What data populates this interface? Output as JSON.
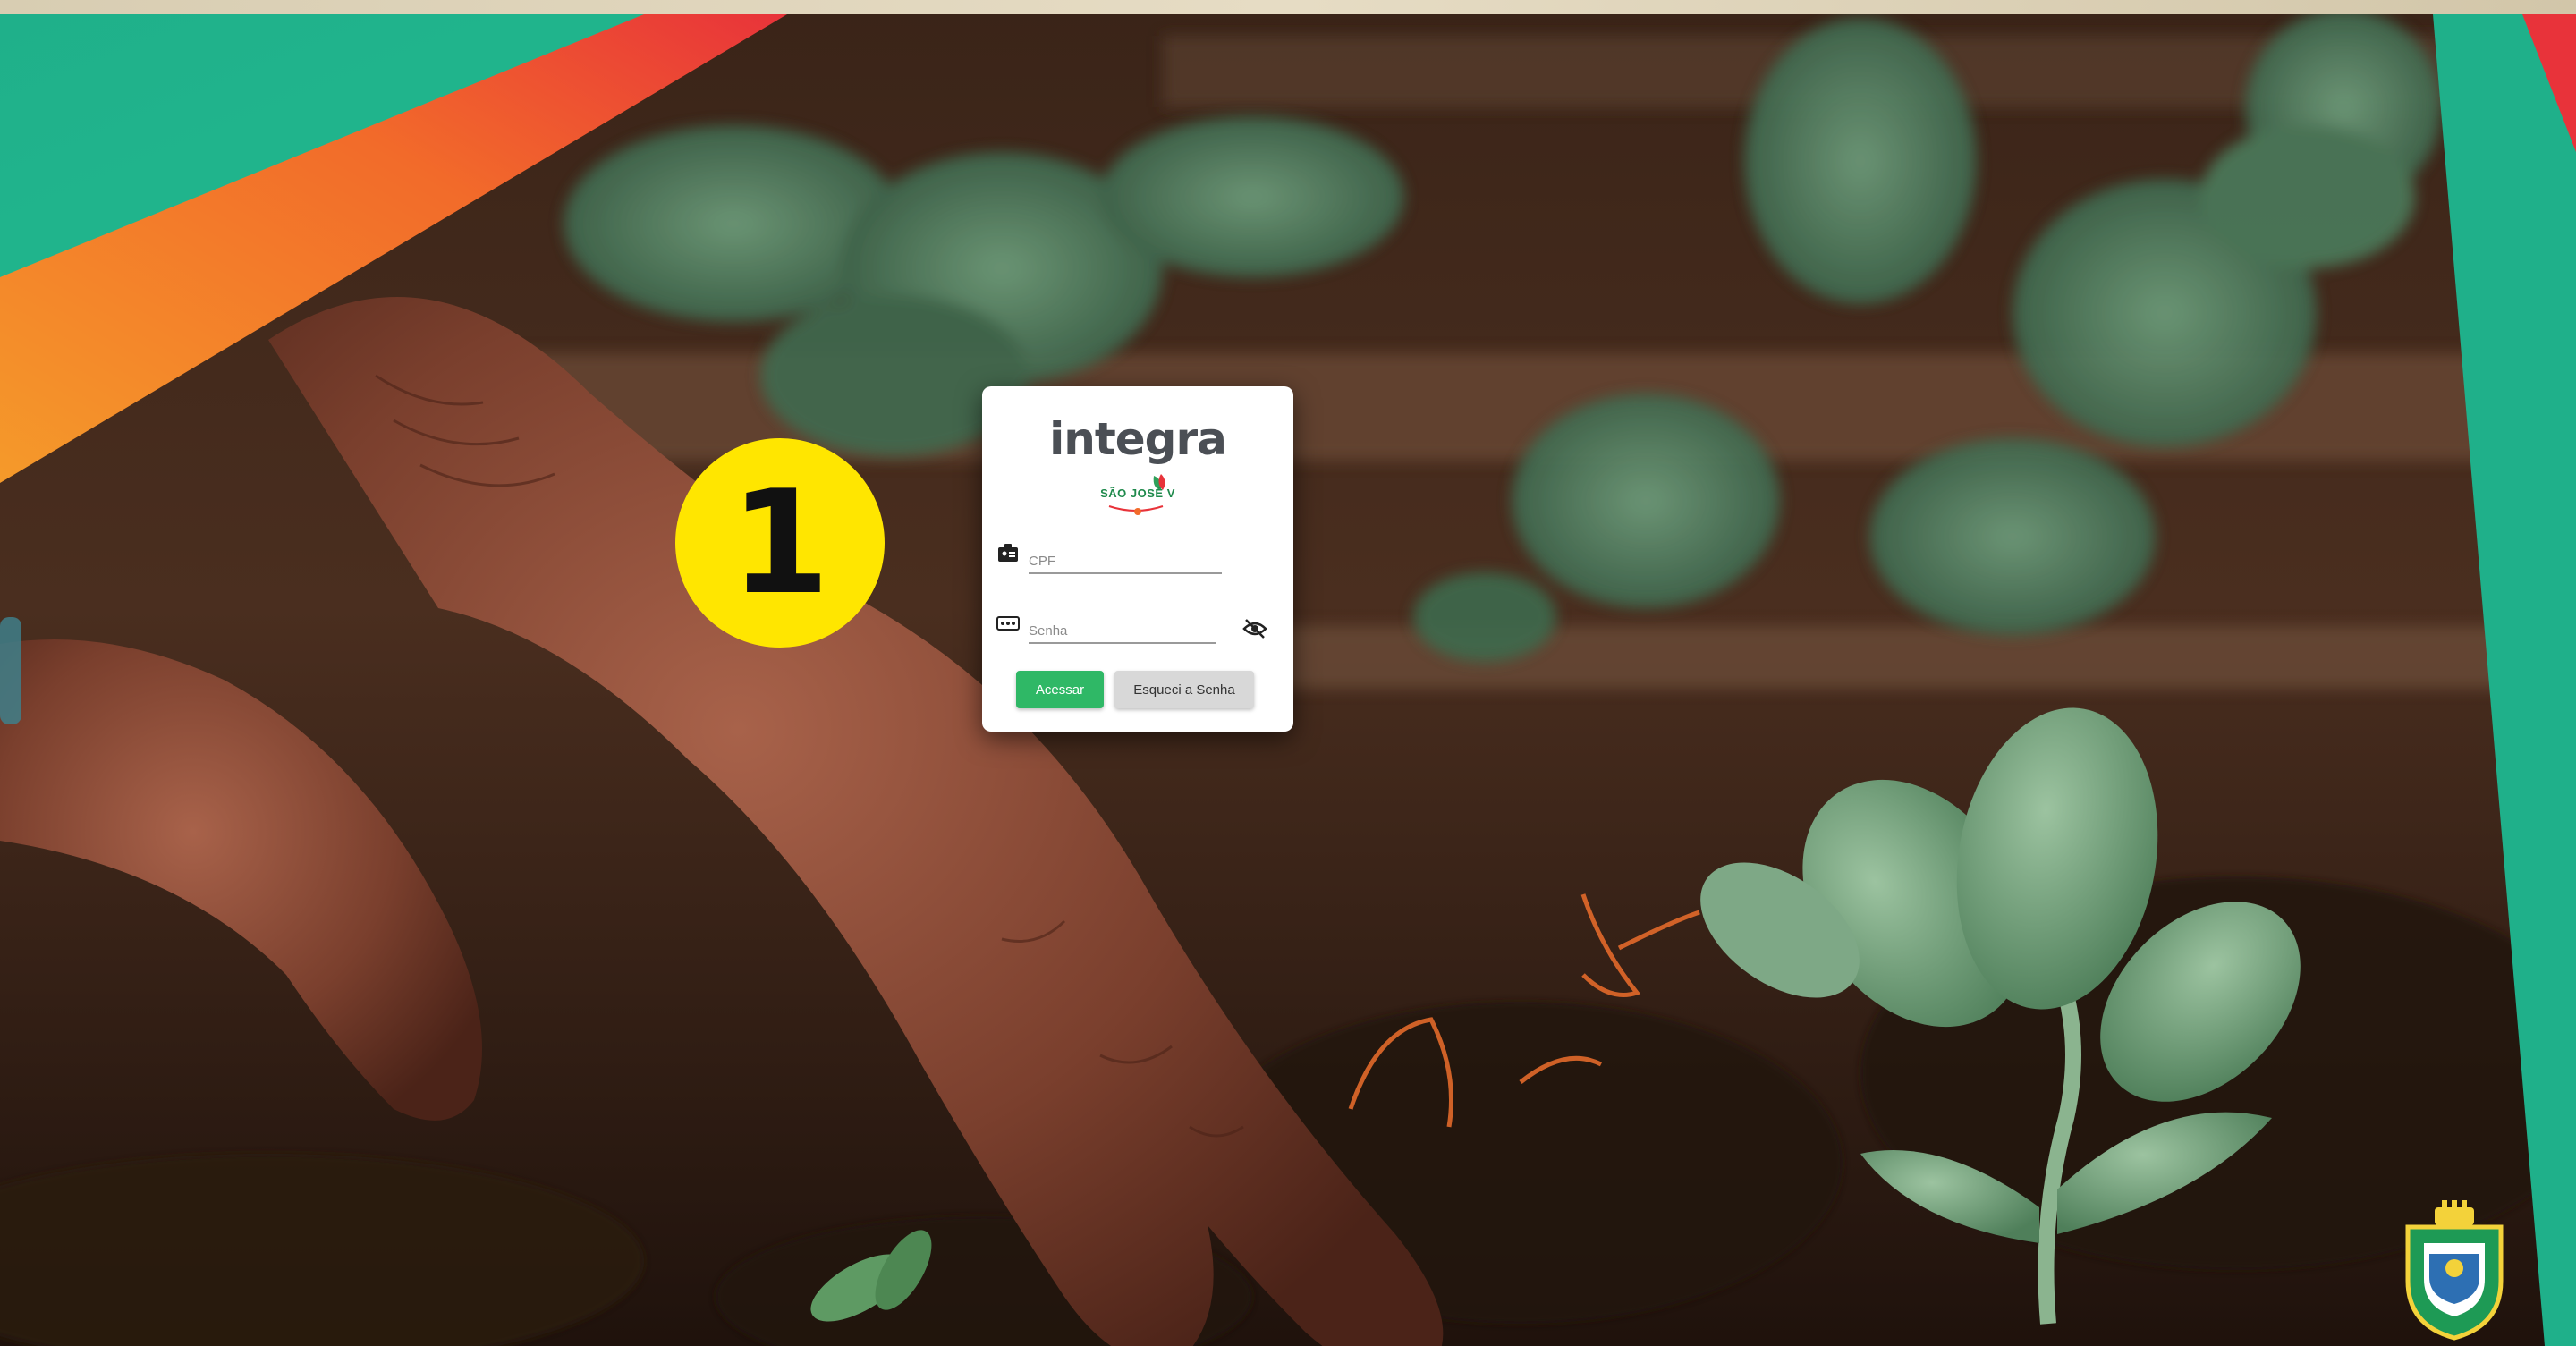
{
  "login": {
    "brand": "integra",
    "sub_brand": "SÃO JOSÉ V",
    "cpf_placeholder": "CPF",
    "password_placeholder": "Senha",
    "submit_label": "Acessar",
    "forgot_label": "Esqueci a Senha"
  },
  "step_badge": {
    "number": "1"
  },
  "icons": {
    "cpf": "id-card-icon",
    "password": "password-dots-icon",
    "visibility": "eye-off-icon"
  },
  "colors": {
    "badge": "#ffe600",
    "primary_button": "#2fb866",
    "secondary_button": "#d8d8d8",
    "brand_text": "#4b4f55",
    "sub_brand": "#1f8a4c",
    "ribbon_teal": "#1fb08a",
    "ribbon_orange": "#f5772a",
    "ribbon_red": "#e8333a"
  }
}
